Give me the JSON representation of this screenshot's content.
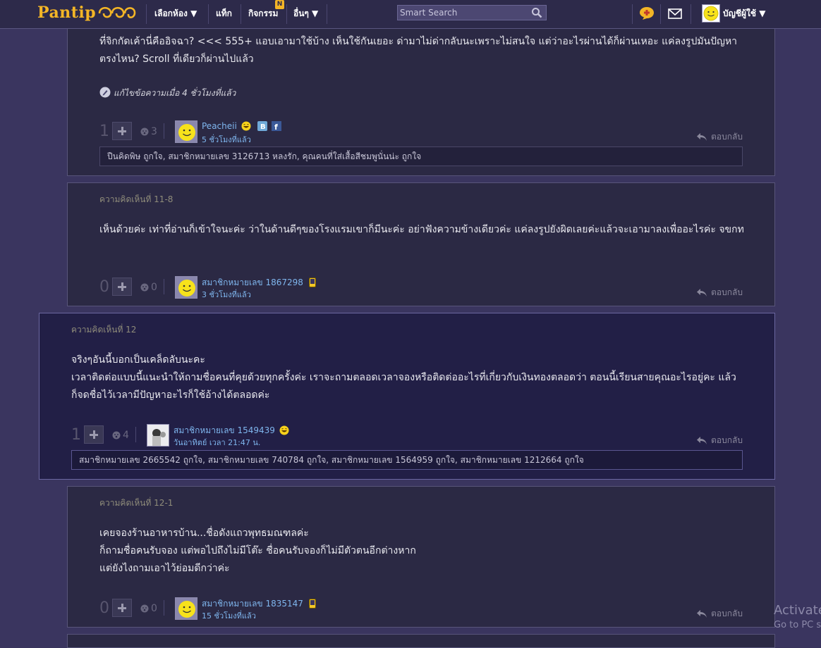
{
  "navbar": {
    "logo": "Pantip",
    "menu": [
      {
        "label": "เลือกห้อง ▼"
      },
      {
        "label": "แท็ก"
      },
      {
        "label": "กิจกรรม"
      },
      {
        "label": "อื่นๆ ▼"
      }
    ],
    "activity_badge": "N",
    "search_placeholder": "Smart Search",
    "account_label": "บัญชีผู้ใช้ ▼"
  },
  "comments": [
    {
      "label": "",
      "body": [
        "ที่จิกกัดเค้านี่คืออิจฉา? <<< 555+ แอบเอามาใช้บ้าง เห็นใช้กันเยอะ ด่ามาไม่ด่ากลับนะเพราะไม่สนใจ แต่ว่าอะไรผ่านได้ก็ผ่านเหอะ แค่ลงรูปมันปัญหาตรงไหน? Scroll ที่เดียวก็ผ่านไปแล้ว"
      ],
      "edited": "แก้ไขข้อความเมื่อ 4 ชั่วโมงที่แล้ว",
      "score": "1",
      "emotion_count": "3",
      "user": "Peacheii",
      "time": "5 ชั่วโมงที่แล้ว",
      "reply": "ตอบกลับ",
      "likes": "ปืนคิดพิษ ถูกใจ, สมาชิกหมายเลข 3126713 หลงรัก, คุณคนที่ใส่เสื้อสีชมพูนั่นน่ะ ถูกใจ"
    },
    {
      "label": "ความคิดเห็นที่ 11-8",
      "body": [
        "เห็นด้วยค่ะ เท่าที่อ่านก็เข้าใจนะค่ะ ว่าในด้านดีๆของโรงแรมเขาก็มีนะค่ะ อย่าฟังความข้างเดียวค่ะ แค่ลงรูปยังผิดเลยค่ะแล้วจะเอามาลงเพื่ออะไรค่ะ จขกท"
      ],
      "score": "0",
      "emotion_count": "0",
      "user": "สมาชิกหมายเลข 1867298",
      "time": "3 ชั่วโมงที่แล้ว",
      "reply": "ตอบกลับ"
    },
    {
      "label": "ความคิดเห็นที่ 12",
      "body": [
        "จริงๆอันนี้บอกเป็นเคล็ดลับนะคะ",
        "เวลาติดต่อแบบนี้แนะนำให้ถามชื่อคนที่คุยด้วยทุกครั้งค่ะ เราจะถามตลอดเวลาจองหรือติดต่ออะไรที่เกี่ยวกับเงินทองตลอดว่า ตอนนี้เรียนสายคุณอะไรอยู่คะ แล้วก็จดชื่อไว้เวลามีปัญหาอะไรก็ใช้อ้างได้ตลอดค่ะ"
      ],
      "score": "1",
      "emotion_count": "4",
      "user": "สมาชิกหมายเลข 1549439",
      "time": "วันอาทิตย์ เวลา 21:47 น.",
      "reply": "ตอบกลับ",
      "likes": "สมาชิกหมายเลข 2665542 ถูกใจ, สมาชิกหมายเลข 740784 ถูกใจ, สมาชิกหมายเลข 1564959 ถูกใจ, สมาชิกหมายเลข 1212664 ถูกใจ"
    },
    {
      "label": "ความคิดเห็นที่ 12-1",
      "body": [
        "เคยจองร้านอาหารบ้าน...ชื่อดังแถวพุทธมณฑลค่ะ",
        "ก็ถามชื่อคนรับจอง แต่พอไปถึงไม่มีโต๊ะ ชื่อคนรับจองก็ไม่มีตัวตนอีกต่างหาก",
        "แต่ยังไงถามเอาไว้ย่อมดีกว่าค่ะ"
      ],
      "score": "0",
      "emotion_count": "0",
      "user": "สมาชิกหมายเลข 1835147",
      "time": "15 ชั่วโมงที่แล้ว",
      "reply": "ตอบกลับ"
    }
  ],
  "os_watermark": {
    "title": "Activate",
    "subtitle": "Go to PC s"
  }
}
